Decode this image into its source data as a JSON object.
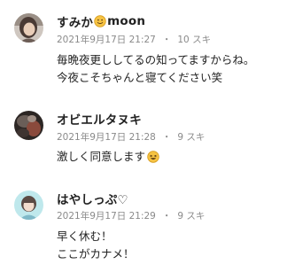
{
  "comments": [
    {
      "name": "すみか",
      "name_suffix": "moon",
      "name_emoji": "smiling-face-icon",
      "date": "2021年9月17日 21:27",
      "likes": "10 スキ",
      "lines": [
        "毎晩夜更ししてるの知ってますからね。",
        "今夜こそちゃんと寝てください笑"
      ]
    },
    {
      "name": "オビエルタヌキ",
      "date": "2021年9月17日 21:28",
      "likes": "9 スキ",
      "lines": [
        "激しく同意します"
      ],
      "line_emoji": "laughing-face-icon"
    },
    {
      "name": "はやしっぷ♡",
      "date": "2021年9月17日 21:29",
      "likes": "9 スキ",
      "lines": [
        "早く休む！",
        "ここがカナメ！"
      ]
    }
  ],
  "separator": "・",
  "colors": {
    "text": "#222222",
    "meta": "#8a8a8a",
    "emoji": "#f6c343"
  }
}
